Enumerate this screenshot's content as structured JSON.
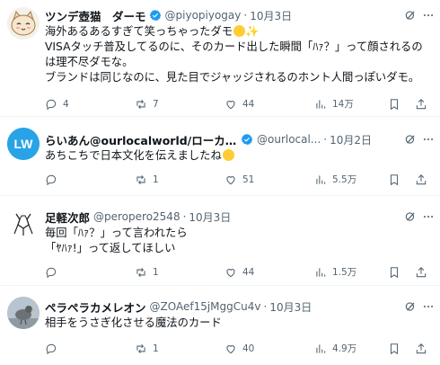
{
  "colors": {
    "verified_blue": "#1d9bf0",
    "muted": "#536471",
    "text": "#0f1419",
    "divider": "#eff3f4"
  },
  "tweets": [
    {
      "name": "ツンデ壺猫　ダーモ",
      "verified": true,
      "handle": "@piyopiyogay",
      "date": "10月3日",
      "lines": [
        "海外あるあるすぎて笑っちゃったダモ",
        "VISAタッチ普及してるのに、そのカード出した瞬間「ﾊｧ？」って顔されるの",
        "は理不尽ダモな。",
        "ブランドは同じなのに、見た目でジャッジされるのホント人間っぽいダモ。"
      ],
      "replies": "4",
      "reposts": "7",
      "likes": "44",
      "views": "14万"
    },
    {
      "name": "らいあん@ourlocalworld/ローカルな世...",
      "verified": true,
      "handle": "@ourlocal...",
      "date": "10月2日",
      "lines": [
        "あちこちで日本文化を伝えましたね"
      ],
      "replies": "",
      "reposts": "1",
      "likes": "51",
      "views": "5.5万"
    },
    {
      "name": "足軽次郎",
      "verified": false,
      "handle": "@peropero2548",
      "date": "10月3日",
      "lines": [
        "毎回「ﾊｧ？」って言われたら",
        "「ﾔﾊｧ!」って返してほしい"
      ],
      "replies": "",
      "reposts": "1",
      "likes": "44",
      "views": "1.5万"
    },
    {
      "name": "ペラペラカメレオン",
      "verified": false,
      "handle": "@ZOAef15jMggCu4v",
      "date": "10月3日",
      "lines": [
        "相手をうさぎ化させる魔法のカード"
      ],
      "replies": "",
      "reposts": "1",
      "likes": "40",
      "views": "4.9万"
    }
  ]
}
